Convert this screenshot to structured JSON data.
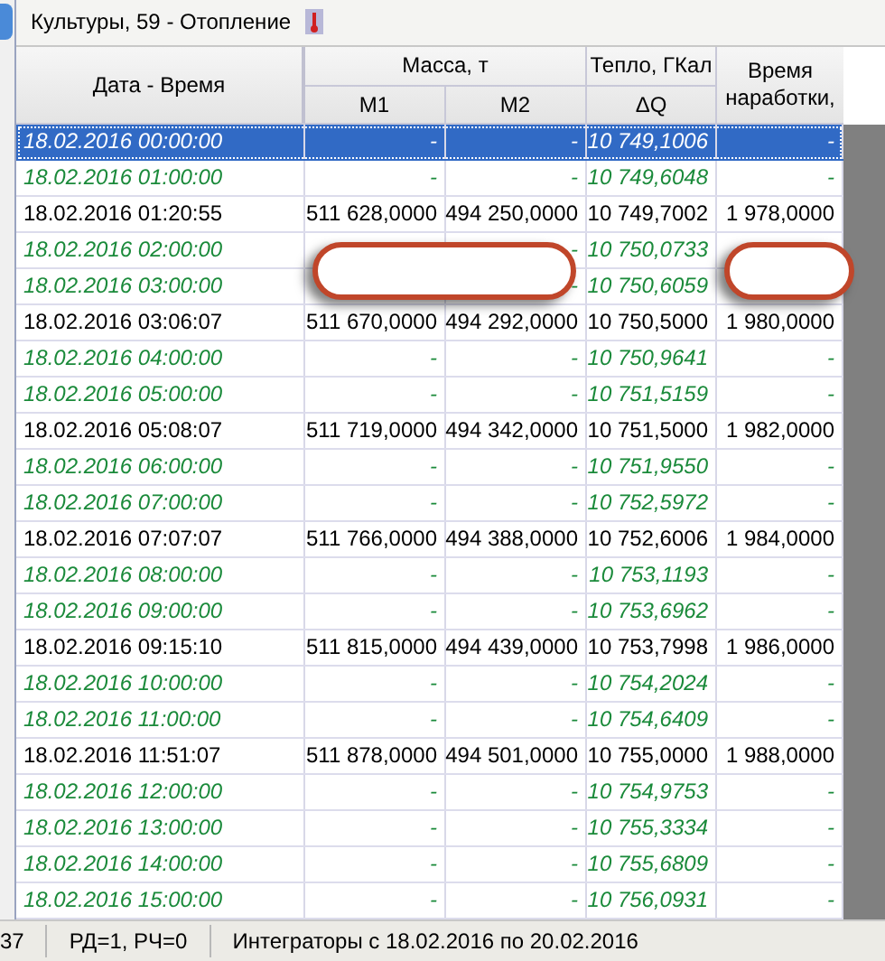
{
  "title": "Культуры, 59 - Отопление",
  "header": {
    "date": "Дата - Время",
    "mass": "Масса, т",
    "heat": "Тепло, ГКал",
    "m1": "М1",
    "m2": "М2",
    "dq": "ΔQ",
    "hours": "Время наработки,"
  },
  "rows": [
    {
      "kind": "hourly",
      "selected": true,
      "date": "18.02.2016 00:00:00",
      "m1": "-",
      "m2": "-",
      "dq": "10 749,1006",
      "hours": "-"
    },
    {
      "kind": "hourly",
      "selected": false,
      "date": "18.02.2016 01:00:00",
      "m1": "-",
      "m2": "-",
      "dq": "10 749,6048",
      "hours": "-"
    },
    {
      "kind": "event",
      "selected": false,
      "date": "18.02.2016 01:20:55",
      "m1": "511 628,0000",
      "m2": "494 250,0000",
      "dq": "10 749,7002",
      "hours": "1 978,0000"
    },
    {
      "kind": "hourly",
      "selected": false,
      "date": "18.02.2016 02:00:00",
      "m2": "-",
      "dq": "10 750,0733"
    },
    {
      "kind": "hourly",
      "selected": false,
      "date": "18.02.2016 03:00:00",
      "m2": "-",
      "dq": "10 750,6059"
    },
    {
      "kind": "event",
      "selected": false,
      "date": "18.02.2016 03:06:07",
      "m1": "511 670,0000",
      "m2": "494 292,0000",
      "dq": "10 750,5000",
      "hours": "1 980,0000"
    },
    {
      "kind": "hourly",
      "selected": false,
      "date": "18.02.2016 04:00:00",
      "m1": "-",
      "m2": "-",
      "dq": "10 750,9641",
      "hours": "-"
    },
    {
      "kind": "hourly",
      "selected": false,
      "date": "18.02.2016 05:00:00",
      "m1": "-",
      "m2": "-",
      "dq": "10 751,5159",
      "hours": "-"
    },
    {
      "kind": "event",
      "selected": false,
      "date": "18.02.2016 05:08:07",
      "m1": "511 719,0000",
      "m2": "494 342,0000",
      "dq": "10 751,5000",
      "hours": "1 982,0000"
    },
    {
      "kind": "hourly",
      "selected": false,
      "date": "18.02.2016 06:00:00",
      "m1": "-",
      "m2": "-",
      "dq": "10 751,9550",
      "hours": "-"
    },
    {
      "kind": "hourly",
      "selected": false,
      "date": "18.02.2016 07:00:00",
      "m1": "-",
      "m2": "-",
      "dq": "10 752,5972",
      "hours": "-"
    },
    {
      "kind": "event",
      "selected": false,
      "date": "18.02.2016 07:07:07",
      "m1": "511 766,0000",
      "m2": "494 388,0000",
      "dq": "10 752,6006",
      "hours": "1 984,0000"
    },
    {
      "kind": "hourly",
      "selected": false,
      "date": "18.02.2016 08:00:00",
      "m1": "-",
      "m2": "-",
      "dq": "10 753,1193",
      "hours": "-"
    },
    {
      "kind": "hourly",
      "selected": false,
      "date": "18.02.2016 09:00:00",
      "m1": "-",
      "m2": "-",
      "dq": "10 753,6962",
      "hours": "-"
    },
    {
      "kind": "event",
      "selected": false,
      "date": "18.02.2016 09:15:10",
      "m1": "511 815,0000",
      "m2": "494 439,0000",
      "dq": "10 753,7998",
      "hours": "1 986,0000"
    },
    {
      "kind": "hourly",
      "selected": false,
      "date": "18.02.2016 10:00:00",
      "m1": "-",
      "m2": "-",
      "dq": "10 754,2024",
      "hours": "-"
    },
    {
      "kind": "hourly",
      "selected": false,
      "date": "18.02.2016 11:00:00",
      "m1": "-",
      "m2": "-",
      "dq": "10 754,6409",
      "hours": "-"
    },
    {
      "kind": "event",
      "selected": false,
      "date": "18.02.2016 11:51:07",
      "m1": "511 878,0000",
      "m2": "494 501,0000",
      "dq": "10 755,0000",
      "hours": "1 988,0000"
    },
    {
      "kind": "hourly",
      "selected": false,
      "date": "18.02.2016 12:00:00",
      "m1": "-",
      "m2": "-",
      "dq": "10 754,9753",
      "hours": "-"
    },
    {
      "kind": "hourly",
      "selected": false,
      "date": "18.02.2016 13:00:00",
      "m1": "-",
      "m2": "-",
      "dq": "10 755,3334",
      "hours": "-"
    },
    {
      "kind": "hourly",
      "selected": false,
      "date": "18.02.2016 14:00:00",
      "m1": "-",
      "m2": "-",
      "dq": "10 755,6809",
      "hours": "-"
    },
    {
      "kind": "hourly",
      "selected": false,
      "date": "18.02.2016 15:00:00",
      "m1": "-",
      "m2": "-",
      "dq": "10 756,0931",
      "hours": "-"
    }
  ],
  "annotations": [
    {
      "kind": "oval"
    },
    {
      "kind": "oval"
    }
  ],
  "status_bar": [
    "37",
    "РД=1, РЧ=0",
    "Интеграторы с 18.02.2016 по 20.02.2016"
  ]
}
